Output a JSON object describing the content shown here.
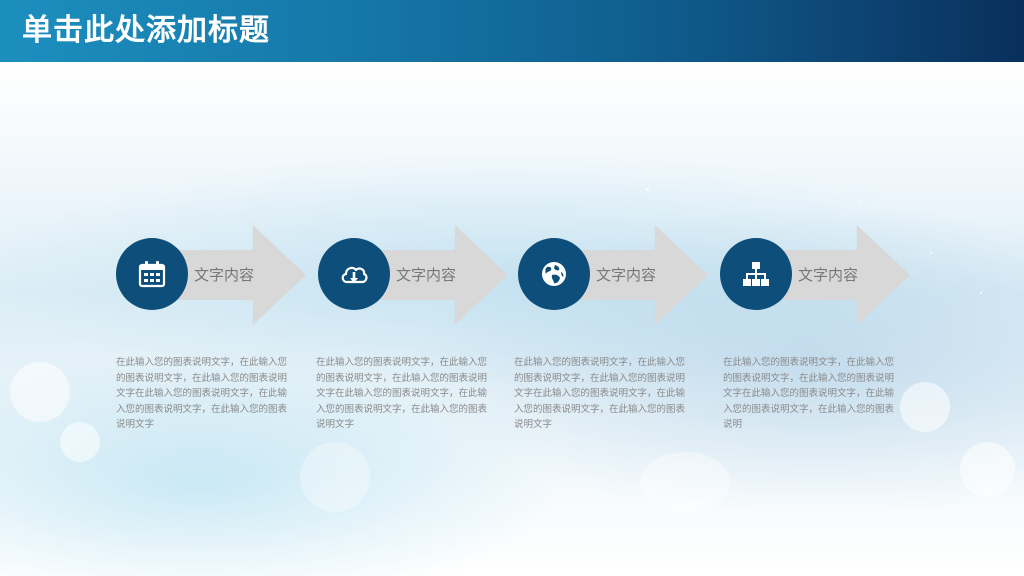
{
  "header": {
    "title": "单击此处添加标题"
  },
  "steps": [
    {
      "icon": "calendar-icon",
      "label": "文字内容",
      "description": "在此输入您的图表说明文字，在此输入您的图表说明文字，在此输入您的图表说明文字在此输入您的图表说明文字，在此输入您的图表说明文字，在此输入您的图表说明文字"
    },
    {
      "icon": "cloud-download-icon",
      "label": "文字内容",
      "description": "在此输入您的图表说明文字，在此输入您的图表说明文字，在此输入您的图表说明文字在此输入您的图表说明文字，在此输入您的图表说明文字，在此输入您的图表说明文字"
    },
    {
      "icon": "globe-icon",
      "label": "文字内容",
      "description": "在此输入您的图表说明文字，在此输入您的图表说明文字，在此输入您的图表说明文字在此输入您的图表说明文字，在此输入您的图表说明文字，在此输入您的图表说明文字"
    },
    {
      "icon": "org-chart-icon",
      "label": "文字内容",
      "description": "在此输入您的图表说明文字，在此输入您的图表说明文字，在此输入您的图表说明文字在此输入您的图表说明文字，在此输入您的图表说明文字，在此输入您的图表说明"
    }
  ],
  "colors": {
    "header_start": "#1c8fbf",
    "header_end": "#0a2f5c",
    "circle": "#0d4f7a",
    "arrow": "#d8d8d8",
    "label_text": "#777777",
    "desc_text": "#8a8a8a"
  }
}
